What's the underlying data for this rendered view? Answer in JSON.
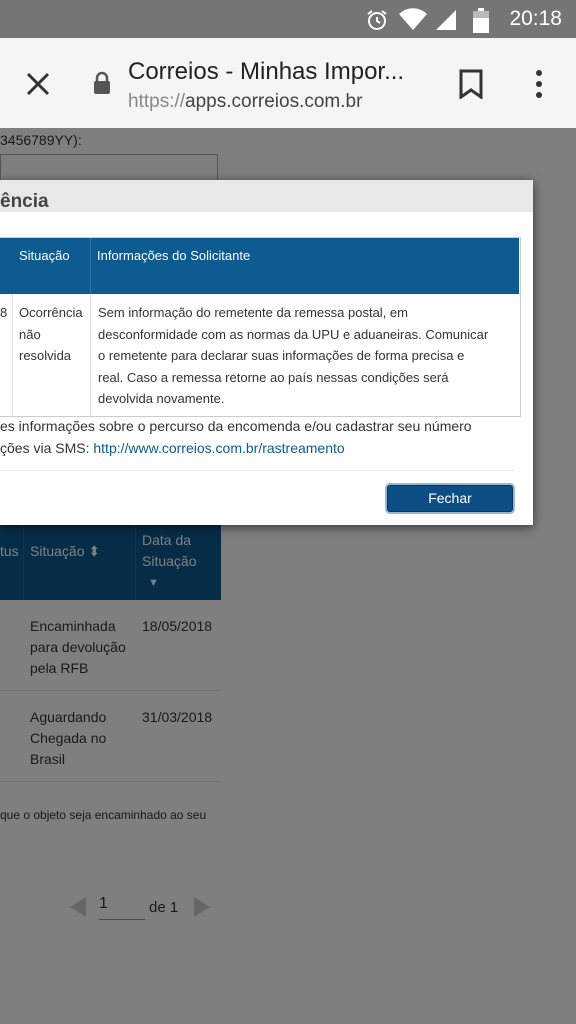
{
  "status_bar": {
    "time": "20:18"
  },
  "browser": {
    "title": "Correios - Minhas Impor...",
    "url_scheme": "https://",
    "url_host": "apps.correios.com.br"
  },
  "page": {
    "code_label": "3456789YY):",
    "table_headers": {
      "status": "tus",
      "situacao": "Situação ⬍",
      "data_line1": "Data da",
      "data_line2": "Situação",
      "data_sort": "▼"
    },
    "rows": [
      {
        "situacao": [
          "Encaminhada",
          "para devolução",
          "pela RFB"
        ],
        "data": "18/05/2018"
      },
      {
        "situacao": [
          "Aguardando",
          "Chegada no",
          "Brasil"
        ],
        "data": "31/03/2018"
      }
    ],
    "footnote": "que o objeto seja encaminhado ao seu",
    "pager": {
      "page": "1",
      "of_label": "de 1"
    }
  },
  "modal": {
    "title": "ência",
    "col_situacao": "Situação",
    "col_info": "Informações do Solicitante",
    "row_date_fragment": "8",
    "row_situacao": [
      "Ocorrência",
      "não",
      "resolvida"
    ],
    "row_info": [
      "Sem informação do remetente da remessa postal, em",
      "desconformidade com as normas da UPU e aduaneiras. Comunicar",
      "o remetente para declarar suas informações de forma precisa e",
      "real. Caso a remessa retorne ao país nessas condições será",
      "devolvida novamente."
    ],
    "footer_line1": "es informações sobre o percurso da encomenda e/ou cadastrar seu número",
    "footer_line2_prefix": "ções via SMS: ",
    "footer_link": "http://www.correios.com.br/rastreamento",
    "close_button": "Fechar"
  },
  "icons": [
    "alarm-icon",
    "wifi-icon",
    "signal-icon",
    "battery-icon",
    "close-icon",
    "lock-icon",
    "bookmark-icon",
    "more-icon",
    "prev-page-icon",
    "next-page-icon"
  ],
  "colors": {
    "header_blue": "#0d5b91",
    "button_blue": "#0d4f84",
    "status_bar": "#757575"
  }
}
